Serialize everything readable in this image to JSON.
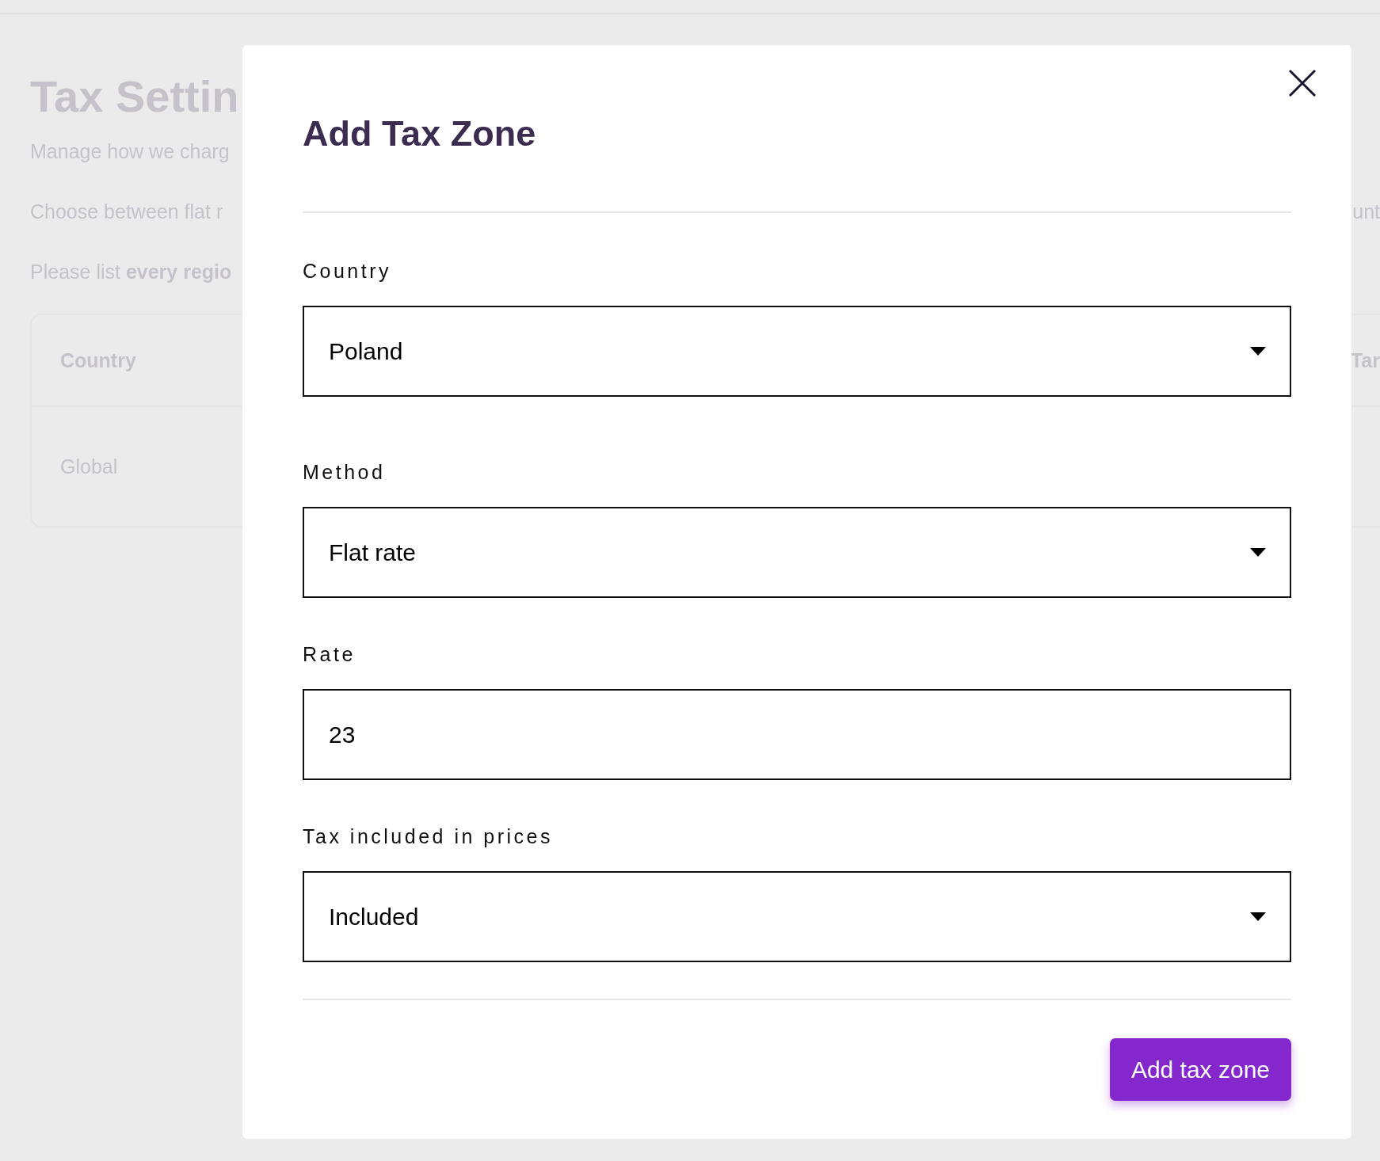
{
  "page": {
    "title": "Tax Settin",
    "lines": [
      {
        "text": "Manage how we charg"
      },
      {
        "text": "Choose between flat r",
        "right": "unt"
      },
      {
        "text": "Please list **every regio**"
      }
    ],
    "table": {
      "columns": [
        "Country",
        "Tar"
      ],
      "rows": [
        [
          "Global"
        ]
      ]
    }
  },
  "dialog": {
    "title": "Add Tax Zone",
    "fields": [
      {
        "label": "Country",
        "kind": "select",
        "value": "Poland"
      },
      {
        "label": "Method",
        "kind": "select",
        "value": "Flat rate"
      },
      {
        "label": "Rate",
        "kind": "input",
        "value": "23"
      },
      {
        "label": "Tax included in prices",
        "kind": "select",
        "value": "Included"
      }
    ],
    "button": "Add tax zone"
  }
}
